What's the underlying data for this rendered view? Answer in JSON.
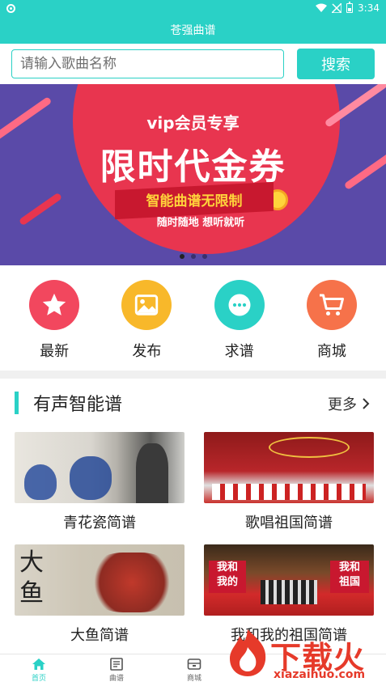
{
  "status": {
    "time": "3:34"
  },
  "app": {
    "title": "苍强曲谱"
  },
  "search": {
    "placeholder": "请输入歌曲名称",
    "button_label": "搜索"
  },
  "banner": {
    "vip_text": "vip会员专享",
    "title": "限时代金券",
    "subtitle": "智能曲谱无限制",
    "tagline": "随时随地 想听就听",
    "page_count": 3,
    "active_index": 0
  },
  "quick_nav": [
    {
      "label": "最新",
      "icon": "star-icon",
      "color": "#f2475e"
    },
    {
      "label": "发布",
      "icon": "image-icon",
      "color": "#f8b82a"
    },
    {
      "label": "求谱",
      "icon": "chat-icon",
      "color": "#2ad1c6"
    },
    {
      "label": "商城",
      "icon": "cart-icon",
      "color": "#f6724a"
    }
  ],
  "section": {
    "title": "有声智能谱",
    "more_label": "更多"
  },
  "scores": [
    {
      "title": "青花瓷简谱"
    },
    {
      "title": "歌唱祖国简谱"
    },
    {
      "title": "大鱼简谱"
    },
    {
      "title": "我和我的祖国简谱"
    }
  ],
  "bottom_nav": [
    {
      "label": "首页",
      "icon": "home-icon",
      "active": true
    },
    {
      "label": "曲谱",
      "icon": "score-icon",
      "active": false
    },
    {
      "label": "商城",
      "icon": "shop-icon",
      "active": false
    }
  ],
  "watermark": {
    "text": "下载火",
    "url": "xiazaihuo.com"
  }
}
